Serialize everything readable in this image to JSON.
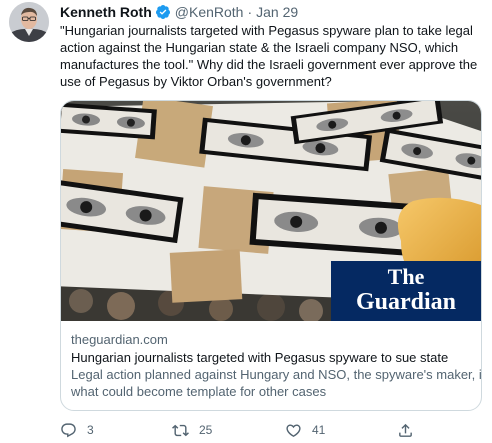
{
  "tweet": {
    "author_name": "Kenneth Roth",
    "handle": "@KenRoth",
    "separator": "·",
    "date": "Jan 29",
    "text_lines": [
      "\"Hungarian journalists targeted with Pegasus spyware plan to take legal",
      "action against the Hungarian state & the Israeli company NSO, which",
      "manufactures the tool.\" Why did the Israeli government ever approve the",
      "use of Pegasus by Viktor Orban's government?"
    ]
  },
  "card": {
    "logo_line1": "The",
    "logo_line2": "Guardian",
    "domain": "theguardian.com",
    "title": "Hungarian journalists targeted with Pegasus spyware to sue state",
    "description_lines": [
      "Legal action planned against Hungary and NSO, the spyware's maker, in",
      "what could become template for other cases"
    ]
  },
  "actions": {
    "reply_count": "3",
    "retweet_count": "25",
    "like_count": "41"
  },
  "colors": {
    "verified": "#1d9bf0",
    "secondary_text": "#536471",
    "guardian_blue": "#052962"
  },
  "icons": [
    "avatar",
    "verified-badge-icon",
    "reply-icon",
    "retweet-icon",
    "like-icon",
    "share-icon"
  ]
}
